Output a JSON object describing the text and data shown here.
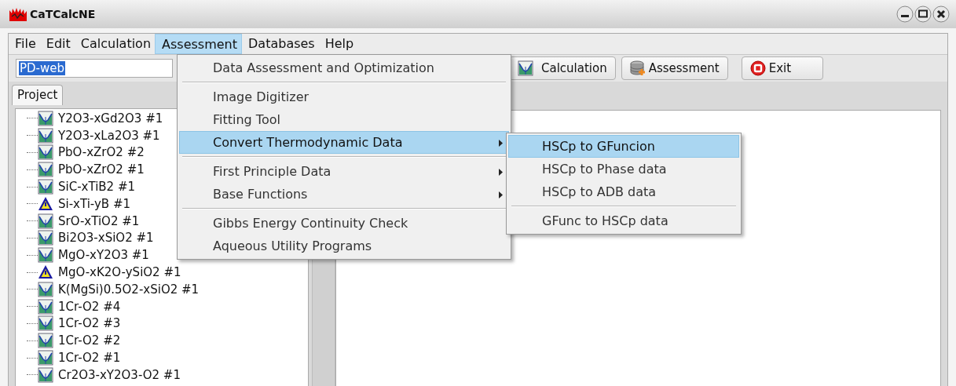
{
  "window": {
    "title": "CaTCalcNE"
  },
  "menubar": [
    {
      "label": "File",
      "selected": false
    },
    {
      "label": "Edit",
      "selected": false
    },
    {
      "label": "Calculation",
      "selected": false
    },
    {
      "label": "Assessment",
      "selected": true
    },
    {
      "label": "Databases",
      "selected": false
    },
    {
      "label": "Help",
      "selected": false
    }
  ],
  "project_field": {
    "value": "PD-web"
  },
  "toolbar": [
    {
      "label": "Calculation",
      "kind": "chart"
    },
    {
      "label": "Assessment",
      "kind": "database"
    },
    {
      "label": "Exit",
      "kind": "stop"
    }
  ],
  "tabs": [
    {
      "label": "Project",
      "selected": true
    }
  ],
  "tree": [
    {
      "label": "Y2O3-xGd2O3 #1",
      "kind": "chart"
    },
    {
      "label": "Y2O3-xLa2O3 #1",
      "kind": "chart"
    },
    {
      "label": "PbO-xZrO2 #2",
      "kind": "chart"
    },
    {
      "label": "PbO-xZrO2 #1",
      "kind": "chart"
    },
    {
      "label": "SiC-xTiB2 #1",
      "kind": "chart"
    },
    {
      "label": "Si-xTi-yB #1",
      "kind": "warning"
    },
    {
      "label": "SrO-xTiO2 #1",
      "kind": "chart"
    },
    {
      "label": "Bi2O3-xSiO2 #1",
      "kind": "chart"
    },
    {
      "label": "MgO-xY2O3 #1",
      "kind": "chart"
    },
    {
      "label": "MgO-xK2O-ySiO2 #1",
      "kind": "warning"
    },
    {
      "label": "K(MgSi)0.5O2-xSiO2 #1",
      "kind": "chart"
    },
    {
      "label": "1Cr-O2 #4",
      "kind": "chart"
    },
    {
      "label": "1Cr-O2 #3",
      "kind": "chart"
    },
    {
      "label": "1Cr-O2 #2",
      "kind": "chart"
    },
    {
      "label": "1Cr-O2 #1",
      "kind": "chart"
    },
    {
      "label": "Cr2O3-xY2O3-O2 #1",
      "kind": "chart"
    }
  ],
  "assessment_menu": [
    {
      "kind": "item",
      "label": "Data Assessment and Optimization",
      "selected": false,
      "submenu": false
    },
    {
      "kind": "separator"
    },
    {
      "kind": "item",
      "label": "Image Digitizer",
      "selected": false,
      "submenu": false
    },
    {
      "kind": "item",
      "label": "Fitting Tool",
      "selected": false,
      "submenu": false
    },
    {
      "kind": "item",
      "label": "Convert Thermodynamic Data",
      "selected": true,
      "submenu": true
    },
    {
      "kind": "separator"
    },
    {
      "kind": "item",
      "label": "First Principle Data",
      "selected": false,
      "submenu": true
    },
    {
      "kind": "item",
      "label": "Base Functions",
      "selected": false,
      "submenu": true
    },
    {
      "kind": "separator"
    },
    {
      "kind": "item",
      "label": "Gibbs Energy Continuity Check",
      "selected": false,
      "submenu": false
    },
    {
      "kind": "item",
      "label": "Aqueous Utility Programs",
      "selected": false,
      "submenu": false
    }
  ],
  "convert_submenu": [
    {
      "kind": "item",
      "label": "HSCp to GFuncion",
      "selected": true,
      "submenu": false
    },
    {
      "kind": "item",
      "label": "HSCp to Phase data",
      "selected": false,
      "submenu": false
    },
    {
      "kind": "item",
      "label": "HSCp to ADB data",
      "selected": false,
      "submenu": false
    },
    {
      "kind": "separator"
    },
    {
      "kind": "item",
      "label": "GFunc to HSCp data",
      "selected": false,
      "submenu": false
    }
  ]
}
